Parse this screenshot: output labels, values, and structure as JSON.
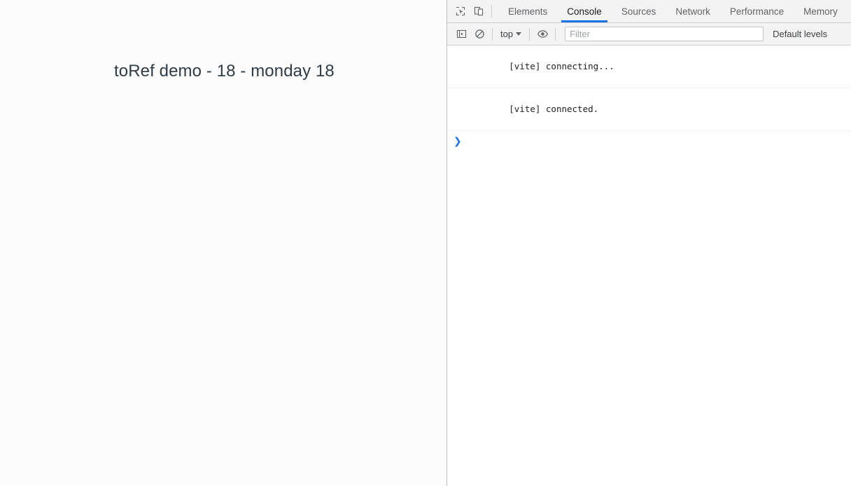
{
  "page": {
    "heading": "toRef demo - 18 - monday 18",
    "background_color": "#fcfcfd",
    "heading_color": "#2f3c46"
  },
  "devtools": {
    "accent_color": "#1a73e8",
    "toolbar_background": "#f3f3f3",
    "icons": {
      "inspect": "inspect-element-icon",
      "device": "device-toolbar-icon",
      "sidebar": "console-sidebar-icon",
      "clear": "clear-console-icon",
      "eye": "live-expression-eye-icon"
    },
    "tabs": [
      {
        "label": "Elements",
        "active": false
      },
      {
        "label": "Console",
        "active": true
      },
      {
        "label": "Sources",
        "active": false
      },
      {
        "label": "Network",
        "active": false
      },
      {
        "label": "Performance",
        "active": false
      },
      {
        "label": "Memory",
        "active": false
      }
    ],
    "console_toolbar": {
      "context": "top",
      "filter_placeholder": "Filter",
      "filter_value": "",
      "levels": "Default levels"
    },
    "console_messages": [
      {
        "text": "[vite] connecting..."
      },
      {
        "text": "[vite] connected."
      }
    ],
    "prompt_symbol": "❯"
  }
}
